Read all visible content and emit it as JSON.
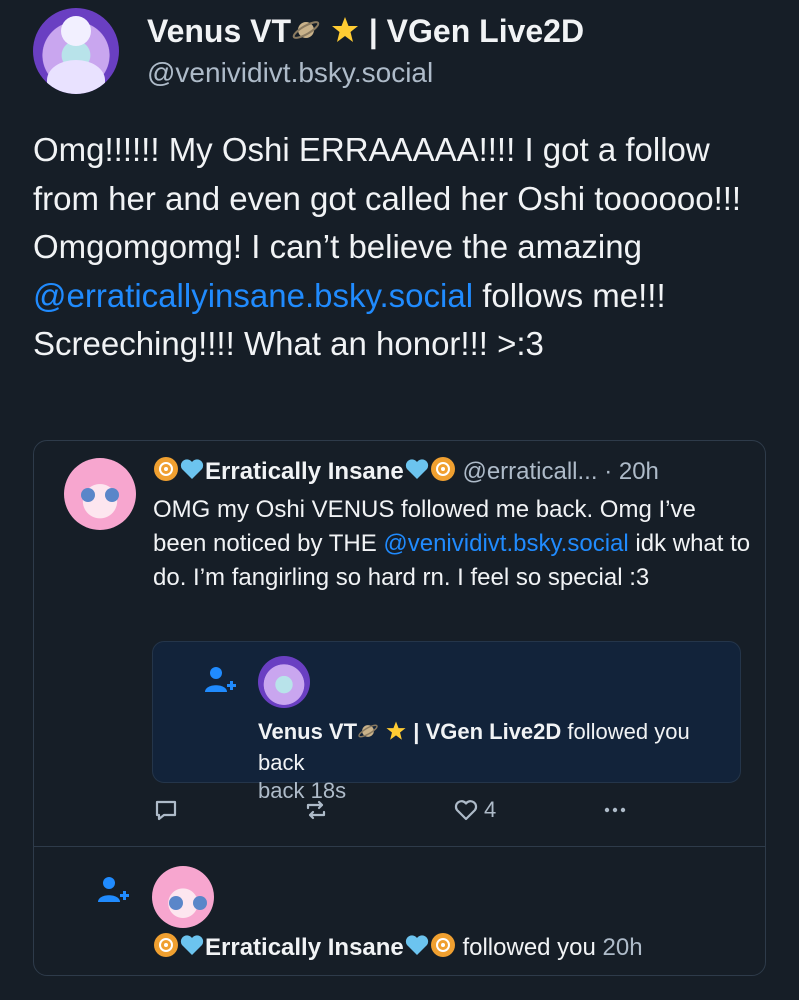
{
  "post": {
    "author_name": "Venus VT",
    "author_name_suffix": "| VGen Live2D",
    "author_handle": "@venividivt.bsky.social",
    "text_part1": "Omg!!!!!! My Oshi ERRAAAAA!!!! I got a follow from her and even got called her Oshi toooooo!!! Omgomgomg! I can’t believe the amazing ",
    "text_mention": "@erraticallyinsane.bsky.social",
    "text_part2": " follows me!!! Screeching!!!! What an honor!!! >:3"
  },
  "quote": {
    "author_name": "Erratically Insane",
    "author_handle": "@erraticall...",
    "time": "· 20h",
    "text_part1": "OMG my Oshi VENUS followed me back. Omg I’ve been noticed by THE ",
    "text_mention": "@venividivt.bsky.social",
    "text_part2": " idk what to do. I’m fangirling so hard rn. I feel so special :3",
    "embedded_notification": {
      "name": "Venus VT",
      "name_suffix": "| VGen Live2D",
      "action": " followed you back",
      "time": " 18s"
    },
    "like_count": "4"
  },
  "bottom_notification": {
    "name": "Erratically Insane",
    "action": " followed you",
    "time": " 20h"
  },
  "colors": {
    "background": "#161e27",
    "mention": "#208bfe",
    "muted": "#aebbc9",
    "border": "#2e3b4a",
    "notification_bg": "#12233a"
  },
  "icons": {
    "planet": "planet-icon",
    "star": "star-icon",
    "biohazard": "biohazard-icon",
    "heart_blue": "blue-heart-icon",
    "follow": "person-plus-icon",
    "reply": "reply-icon",
    "repost": "repost-icon",
    "like": "heart-icon",
    "more": "more-icon"
  }
}
